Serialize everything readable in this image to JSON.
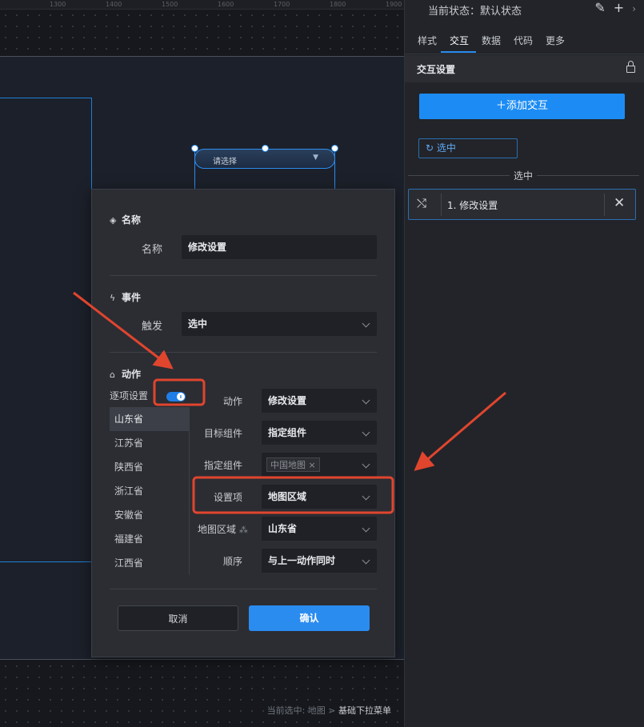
{
  "canvas": {
    "ruler_ticks": [
      "1300",
      "1400",
      "1500",
      "1600",
      "1700",
      "1800",
      "1900"
    ],
    "dropdown_component": {
      "placeholder": "请选择",
      "arrow": "▼"
    },
    "status_bar": {
      "prefix": "当前选中: 地图 >",
      "current": "基础下拉菜单"
    }
  },
  "dialog": {
    "name_section": {
      "title": "名称",
      "label": "名称",
      "value": "修改设置"
    },
    "event_section": {
      "title": "事件",
      "label": "触发",
      "value": "选中"
    },
    "action_section": {
      "title": "动作",
      "per_item_label": "逐项设置",
      "per_item_enabled": true,
      "items": [
        "山东省",
        "江苏省",
        "陕西省",
        "浙江省",
        "安徽省",
        "福建省",
        "江西省"
      ],
      "selected_item": "山东省",
      "fields": {
        "action_label": "动作",
        "action_value": "修改设置",
        "target_label": "目标组件",
        "target_value": "指定组件",
        "specified_label": "指定组件",
        "specified_tag": "中国地图",
        "setting_label": "设置项",
        "setting_value": "地图区域",
        "region_label": "地图区域",
        "region_value": "山东省",
        "order_label": "顺序",
        "order_value": "与上一动作同时"
      }
    },
    "buttons": {
      "cancel": "取消",
      "ok": "确认"
    }
  },
  "panel": {
    "current_state": "当前状态：默认状态",
    "tabs": [
      "样式",
      "交互",
      "数据",
      "代码",
      "更多"
    ],
    "active_tab": "交互",
    "section_title": "交互设置",
    "add_button": "添加交互",
    "trigger_chip": "选中",
    "group_label": "选中",
    "action_item": "1. 修改设置"
  },
  "colors": {
    "accent": "#2b8cf0",
    "annotation": "#e0452e",
    "panel_bg": "#222429"
  }
}
